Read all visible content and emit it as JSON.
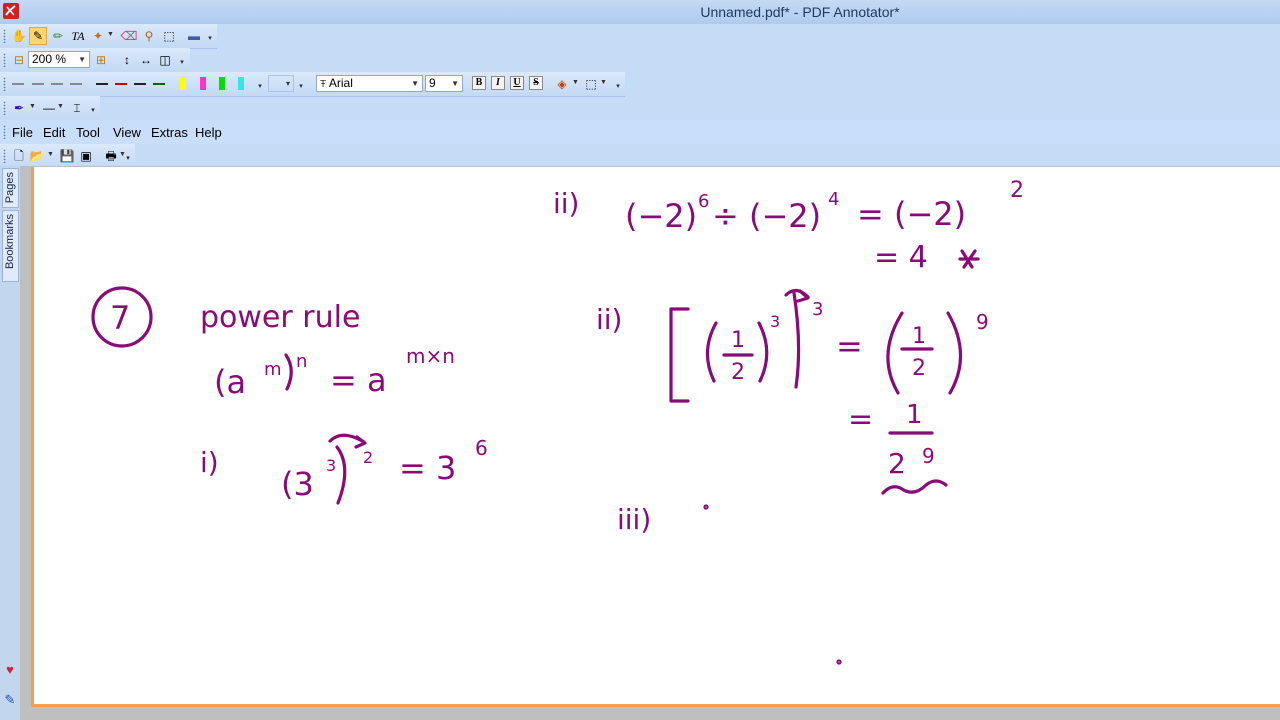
{
  "window": {
    "title": "Unnamed.pdf* - PDF Annotator*"
  },
  "toolbar_view": {
    "zoom_value": "200 %"
  },
  "toolbar_format": {
    "font_name": "Arial",
    "font_size": "9",
    "bold_label": "B",
    "italic_label": "I",
    "underline_label": "U",
    "strike_label": "S",
    "highlight_colors": [
      "#ffff00",
      "#ff33cc",
      "#00e000",
      "#33e6e6"
    ],
    "line_colors": [
      "#222222",
      "#cc0000",
      "#222222",
      "#006600"
    ]
  },
  "menu": {
    "items": [
      "File",
      "Edit",
      "Tool",
      "View",
      "Extras",
      "Help"
    ]
  },
  "side_panel": {
    "tabs": [
      "Pages",
      "Bookmarks"
    ]
  },
  "accent": {
    "ink": "#8b0a7a",
    "page_border": "#f0a050"
  },
  "annotations": {
    "rule_number": "7",
    "heading": "power rule",
    "formula_base": "(a",
    "formula_m": "m",
    "formula_n": "n",
    "formula_eq": "= a",
    "formula_exp": "m×n",
    "ex1_label": "i)",
    "ex1_lhs": "(3",
    "ex1_inner_exp": "3",
    "ex1_outer_exp": "2",
    "ex1_rhs": "= 3",
    "ex1_rhs_exp": "6",
    "ex2a_label": "ii)",
    "ex2a_lhs": "(−2)",
    "ex2a_lhs_exp": "6",
    "ex2a_op": "÷ (−2)",
    "ex2a_op_exp": "4",
    "ex2a_rhs": "= (−2)",
    "ex2a_rhs_exp": "2",
    "ex2a_result": "= 4",
    "ex2b_label": "ii)",
    "ex2b_inner_exp": "3",
    "ex2b_outer_exp": "3",
    "ex2b_rhs_exp": "9",
    "ex2b_eq": "=",
    "ex2b_eq2": "=",
    "ex2b_num": "1",
    "ex2b_den": "2",
    "ex2b_den_exp": "9",
    "ex3_label": "iii)"
  }
}
